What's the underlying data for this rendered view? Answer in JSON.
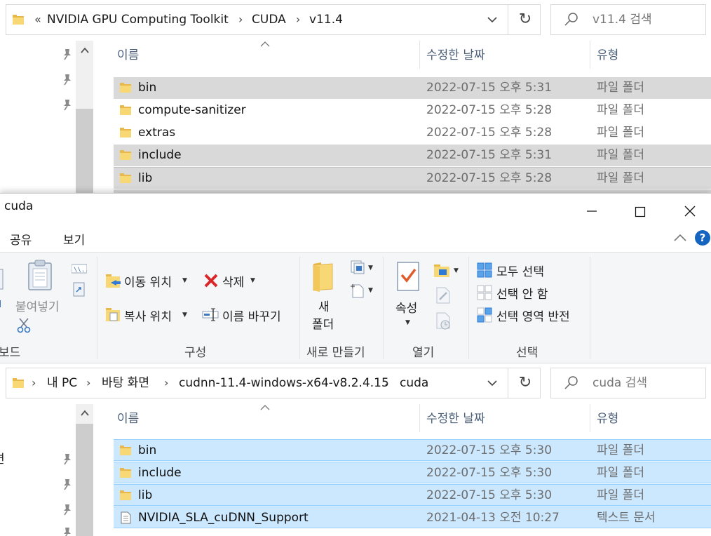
{
  "back_window": {
    "address": {
      "overflow": "«",
      "crumbs": [
        "NVIDIA GPU Computing Toolkit",
        "CUDA",
        "v11.4"
      ]
    },
    "search_placeholder": "v11.4 검색",
    "columns": {
      "name": "이름",
      "date": "수정한 날짜",
      "type": "유형"
    },
    "rows": [
      {
        "name": "bin",
        "date": "2022-07-15 오후 5:31",
        "type": "파일 폴더",
        "state": "selected-inactive"
      },
      {
        "name": "compute-sanitizer",
        "date": "2022-07-15 오후 5:28",
        "type": "파일 폴더",
        "state": "normal"
      },
      {
        "name": "extras",
        "date": "2022-07-15 오후 5:28",
        "type": "파일 폴더",
        "state": "normal"
      },
      {
        "name": "include",
        "date": "2022-07-15 오후 5:31",
        "type": "파일 폴더",
        "state": "selected-inactive"
      },
      {
        "name": "lib",
        "date": "2022-07-15 오후 5:28",
        "type": "파일 폴더",
        "state": "selected-inactive"
      }
    ]
  },
  "front_window": {
    "title": "cuda",
    "tabs": [
      "공유",
      "보기"
    ],
    "ribbon": {
      "clipboard": {
        "paste": "붙여넣기",
        "group_label_partial": "보드"
      },
      "organize": {
        "move_to": "이동 위치",
        "copy_to": "복사 위치",
        "delete": "삭제",
        "rename": "이름 바꾸기",
        "group_label": "구성"
      },
      "new": {
        "new_folder_line1": "새",
        "new_folder_line2": "폴더",
        "group_label": "새로 만들기"
      },
      "open": {
        "properties": "속성",
        "group_label": "열기"
      },
      "select": {
        "select_all": "모두 선택",
        "select_none": "선택 안 함",
        "invert": "선택 영역 반전",
        "group_label": "선택"
      }
    },
    "address": {
      "crumbs": [
        "내 PC",
        "바탕 화면",
        "cudnn-11.4-windows-x64-v8.2.4.15",
        "cuda"
      ]
    },
    "search_placeholder": "cuda 검색",
    "nav_partial_text": "면",
    "columns": {
      "name": "이름",
      "date": "수정한 날짜",
      "type": "유형"
    },
    "rows": [
      {
        "name": "bin",
        "date": "2022-07-15 오후 5:30",
        "type": "파일 폴더",
        "icon": "folder-icon"
      },
      {
        "name": "include",
        "date": "2022-07-15 오후 5:30",
        "type": "파일 폴더",
        "icon": "folder-icon"
      },
      {
        "name": "lib",
        "date": "2022-07-15 오후 5:30",
        "type": "파일 폴더",
        "icon": "folder-icon"
      },
      {
        "name": "NVIDIA_SLA_cuDNN_Support",
        "date": "2021-04-13 오전 10:27",
        "type": "텍스트 문서",
        "icon": "text-document-icon"
      }
    ]
  },
  "colors": {
    "selected_blue": "#cce8ff",
    "selected_border": "#99d1ff",
    "inactive_selection": "#d9d9d9",
    "folder_yellow": "#f8d775",
    "delete_red": "#d9262a"
  }
}
